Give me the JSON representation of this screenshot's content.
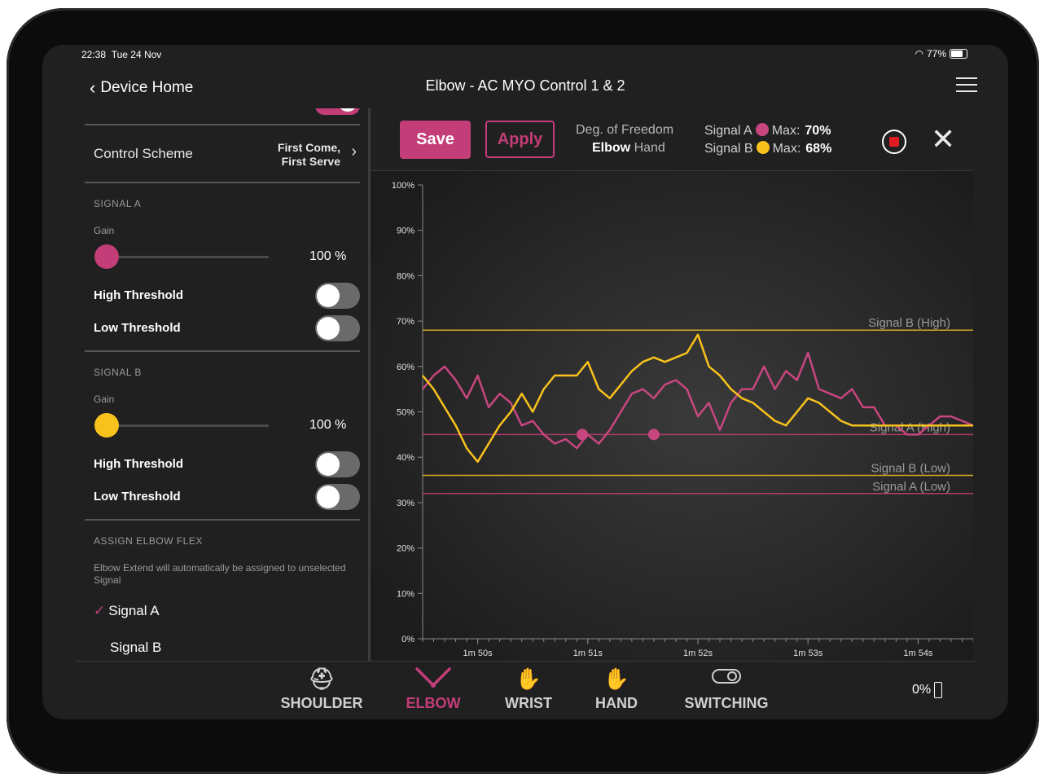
{
  "status": {
    "time": "22:38",
    "date": "Tue 24 Nov",
    "battery": "77%"
  },
  "nav": {
    "back_label": "Device Home",
    "title": "Elbow - AC MYO Control 1 & 2"
  },
  "sidebar": {
    "control_scheme": {
      "label": "Control Scheme",
      "value_line1": "First Come,",
      "value_line2": "First Serve"
    },
    "signal_a": {
      "section": "SIGNAL A",
      "gain_label": "Gain",
      "gain_value": "100 %",
      "high_threshold": "High Threshold",
      "low_threshold": "Low Threshold",
      "color": "#c33d78"
    },
    "signal_b": {
      "section": "SIGNAL B",
      "gain_label": "Gain",
      "gain_value": "100 %",
      "high_threshold": "High Threshold",
      "low_threshold": "Low Threshold",
      "color": "#f8c21c"
    },
    "assign": {
      "section": "ASSIGN ELBOW FLEX",
      "note": "Elbow Extend will automatically be assigned to unselected Signal",
      "option_a": "Signal A",
      "option_b": "Signal B",
      "selected": "Signal A",
      "check": "✓"
    }
  },
  "toolbar": {
    "save_label": "Save",
    "apply_label": "Apply",
    "dof_label": "Deg. of Freedom",
    "dof_elbow": "Elbow",
    "dof_hand": "Hand",
    "signal_a_label": "Signal A",
    "signal_b_label": "Signal B",
    "max_label": "Max:",
    "signal_a_max": "70%",
    "signal_b_max": "68%"
  },
  "chart_data": {
    "type": "line",
    "xlabel": "",
    "ylabel": "",
    "y_ticks": [
      "0%",
      "10%",
      "20%",
      "30%",
      "40%",
      "50%",
      "60%",
      "70%",
      "80%",
      "90%",
      "100%"
    ],
    "x_ticks": [
      "1m 50s",
      "1m 51s",
      "1m 52s",
      "1m 53s",
      "1m 54s"
    ],
    "x_tick_values": [
      110,
      111,
      112,
      113,
      114
    ],
    "xlim": [
      109.5,
      114.5
    ],
    "ylim": [
      0,
      100
    ],
    "grid": false,
    "thresholds": [
      {
        "name": "Signal B (High)",
        "value": 68,
        "color": "#d4a72a"
      },
      {
        "name": "Signal A (High)",
        "value": 45,
        "color": "#b33a6d"
      },
      {
        "name": "Signal B (Low)",
        "value": 36,
        "color": "#d4a72a"
      },
      {
        "name": "Signal A (Low)",
        "value": 32,
        "color": "#b33a6d"
      }
    ],
    "series": [
      {
        "name": "Signal A",
        "color": "#c8467f",
        "x": [
          109.5,
          109.6,
          109.7,
          109.8,
          109.9,
          110.0,
          110.1,
          110.2,
          110.3,
          110.4,
          110.5,
          110.6,
          110.7,
          110.8,
          110.9,
          111.0,
          111.1,
          111.2,
          111.3,
          111.4,
          111.5,
          111.6,
          111.7,
          111.8,
          111.9,
          112.0,
          112.1,
          112.2,
          112.3,
          112.4,
          112.5,
          112.6,
          112.7,
          112.8,
          112.9,
          113.0,
          113.1,
          113.2,
          113.3,
          113.4,
          113.5,
          113.6,
          113.7,
          113.8,
          113.9,
          114.0,
          114.1,
          114.2,
          114.3,
          114.4,
          114.5
        ],
        "y": [
          55,
          58,
          60,
          57,
          53,
          58,
          51,
          54,
          52,
          47,
          48,
          45,
          43,
          44,
          42,
          45,
          43,
          46,
          50,
          54,
          55,
          53,
          56,
          57,
          55,
          49,
          52,
          46,
          52,
          55,
          55,
          60,
          55,
          59,
          57,
          63,
          55,
          54,
          53,
          55,
          51,
          51,
          47,
          47,
          45,
          45,
          47,
          49,
          49,
          48,
          47
        ]
      },
      {
        "name": "Signal B",
        "color": "#f8c21c",
        "x": [
          109.5,
          109.6,
          109.7,
          109.8,
          109.9,
          110.0,
          110.1,
          110.2,
          110.3,
          110.4,
          110.5,
          110.6,
          110.7,
          110.8,
          110.9,
          111.0,
          111.1,
          111.2,
          111.3,
          111.4,
          111.5,
          111.6,
          111.7,
          111.8,
          111.9,
          112.0,
          112.1,
          112.2,
          112.3,
          112.4,
          112.5,
          112.6,
          112.7,
          112.8,
          112.9,
          113.0,
          113.1,
          113.2,
          113.3,
          113.4,
          113.5,
          113.6,
          113.7,
          113.8,
          113.9,
          114.0,
          114.1,
          114.2,
          114.3,
          114.4,
          114.5
        ],
        "y": [
          58,
          55,
          51,
          47,
          42,
          39,
          43,
          47,
          50,
          54,
          50,
          55,
          58,
          58,
          58,
          61,
          55,
          53,
          56,
          59,
          61,
          62,
          61,
          62,
          63,
          67,
          60,
          58,
          55,
          53,
          52,
          50,
          48,
          47,
          50,
          53,
          52,
          50,
          48,
          47,
          47,
          47,
          47,
          47,
          47,
          47,
          47,
          47,
          47,
          47,
          47
        ]
      }
    ],
    "markers": [
      {
        "x": 110.95,
        "y": 45,
        "series": "Signal A"
      },
      {
        "x": 111.6,
        "y": 45,
        "series": "Signal A"
      }
    ]
  },
  "tabs": [
    {
      "label": "SHOULDER",
      "icon": "shoulder-icon",
      "glyph": "⛑"
    },
    {
      "label": "ELBOW",
      "icon": "elbow-icon",
      "glyph": "⟡"
    },
    {
      "label": "WRIST",
      "icon": "wrist-icon",
      "glyph": "✋"
    },
    {
      "label": "HAND",
      "icon": "hand-icon",
      "glyph": "✋"
    },
    {
      "label": "SWITCHING",
      "icon": "switch-icon",
      "glyph": "⊂⊃"
    }
  ],
  "device_battery": "0%"
}
